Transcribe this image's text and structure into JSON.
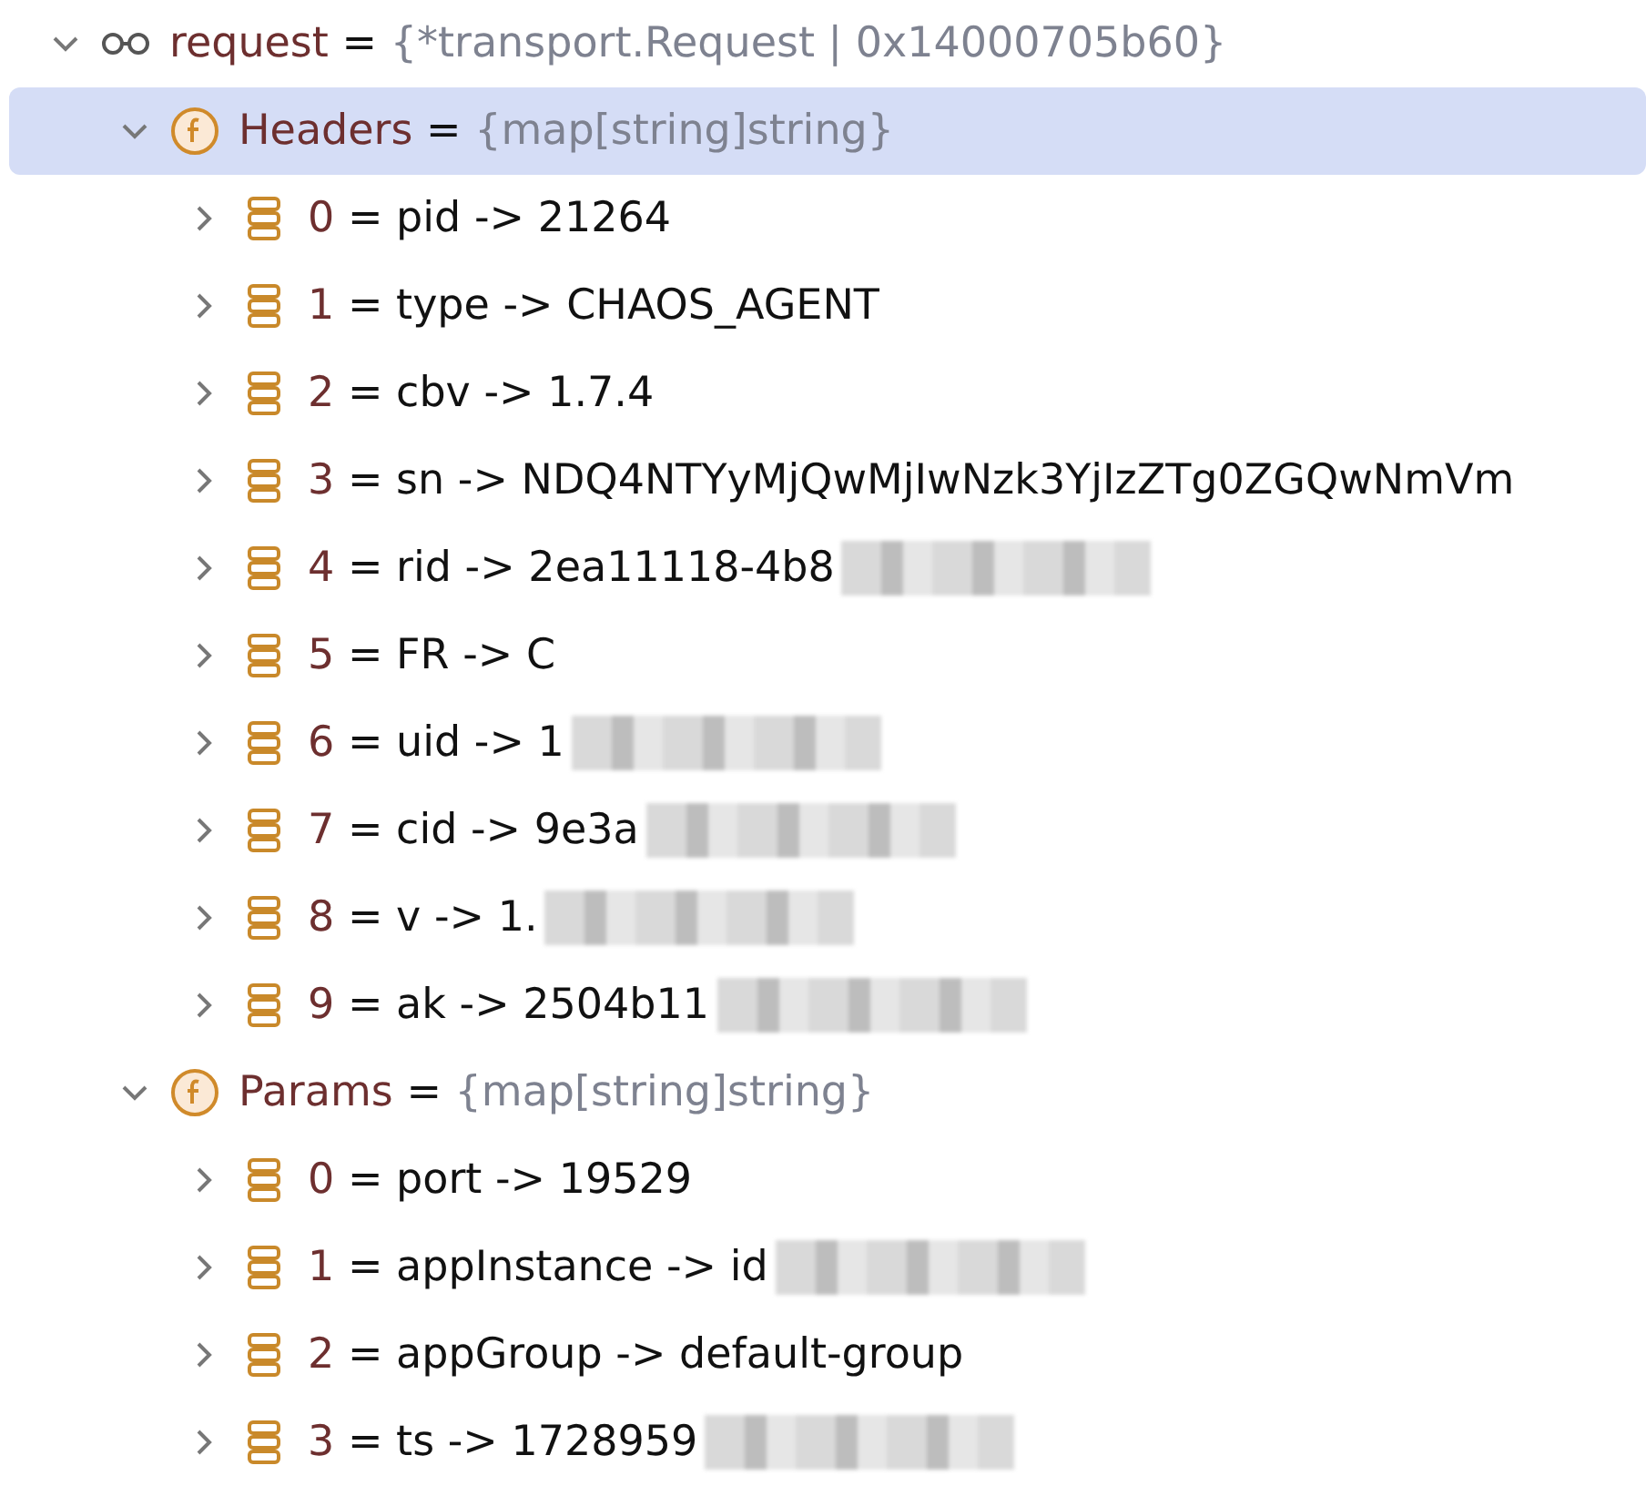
{
  "variable": {
    "name": "request",
    "sep": "=",
    "value": "{*transport.Request | 0x14000705b60}",
    "expanded": true,
    "fields": [
      {
        "name": "Headers",
        "sep": "=",
        "value": "{map[string]string}",
        "expanded": true,
        "selected": true,
        "entries": [
          {
            "index": "0",
            "sep": "=",
            "text": "pid -> 21264",
            "expanded": false,
            "redacted": false
          },
          {
            "index": "1",
            "sep": "=",
            "text": "type -> CHAOS_AGENT",
            "expanded": false,
            "redacted": false
          },
          {
            "index": "2",
            "sep": "=",
            "text": "cbv -> 1.7.4",
            "expanded": false,
            "redacted": false
          },
          {
            "index": "3",
            "sep": "=",
            "text": "sn -> NDQ4NTYyMjQwMjIwNzk3YjIzZTg0ZGQwNmVm",
            "expanded": false,
            "redacted": false
          },
          {
            "index": "4",
            "sep": "=",
            "text": "rid -> 2ea11118-4b8",
            "expanded": false,
            "redacted": true
          },
          {
            "index": "5",
            "sep": "=",
            "text": "FR -> C",
            "expanded": false,
            "redacted": false
          },
          {
            "index": "6",
            "sep": "=",
            "text": "uid -> 1",
            "expanded": false,
            "redacted": true
          },
          {
            "index": "7",
            "sep": "=",
            "text": "cid -> 9e3a",
            "expanded": false,
            "redacted": true
          },
          {
            "index": "8",
            "sep": "=",
            "text": "v -> 1.",
            "expanded": false,
            "redacted": true
          },
          {
            "index": "9",
            "sep": "=",
            "text": "ak -> 2504b11",
            "expanded": false,
            "redacted": true
          }
        ]
      },
      {
        "name": "Params",
        "sep": "=",
        "value": "{map[string]string}",
        "expanded": true,
        "selected": false,
        "entries": [
          {
            "index": "0",
            "sep": "=",
            "text": "port -> 19529",
            "expanded": false,
            "redacted": false
          },
          {
            "index": "1",
            "sep": "=",
            "text": "appInstance -> id",
            "expanded": false,
            "redacted": true
          },
          {
            "index": "2",
            "sep": "=",
            "text": "appGroup -> default-group",
            "expanded": false,
            "redacted": false
          },
          {
            "index": "3",
            "sep": "=",
            "text": "ts -> 1728959",
            "expanded": false,
            "redacted": true
          }
        ]
      }
    ]
  }
}
